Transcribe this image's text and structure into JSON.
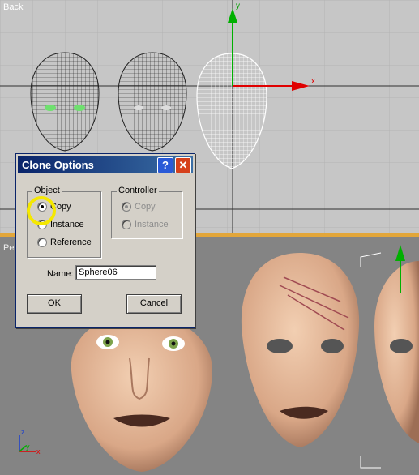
{
  "viewports": {
    "top": {
      "label": "Back"
    },
    "bottom": {
      "label": "Pers"
    }
  },
  "axis_labels": {
    "x": "x",
    "y": "y",
    "z": "z"
  },
  "dialog": {
    "title": "Clone Options",
    "help_glyph": "?",
    "close_glyph": "✕",
    "object_group": {
      "label": "Object",
      "options": [
        "Copy",
        "Instance",
        "Reference"
      ],
      "selected": "Copy"
    },
    "controller_group": {
      "label": "Controller",
      "options": [
        "Copy",
        "Instance"
      ],
      "selected": "Copy",
      "disabled": true
    },
    "name_label": "Name:",
    "name_value": "Sphere06",
    "ok_label": "OK",
    "cancel_label": "Cancel"
  },
  "colors": {
    "titlebar": "#0a246a",
    "highlight": "#f5e800",
    "axis_x": "#e00000",
    "axis_y": "#00b000",
    "skin": "#e3b89a"
  }
}
